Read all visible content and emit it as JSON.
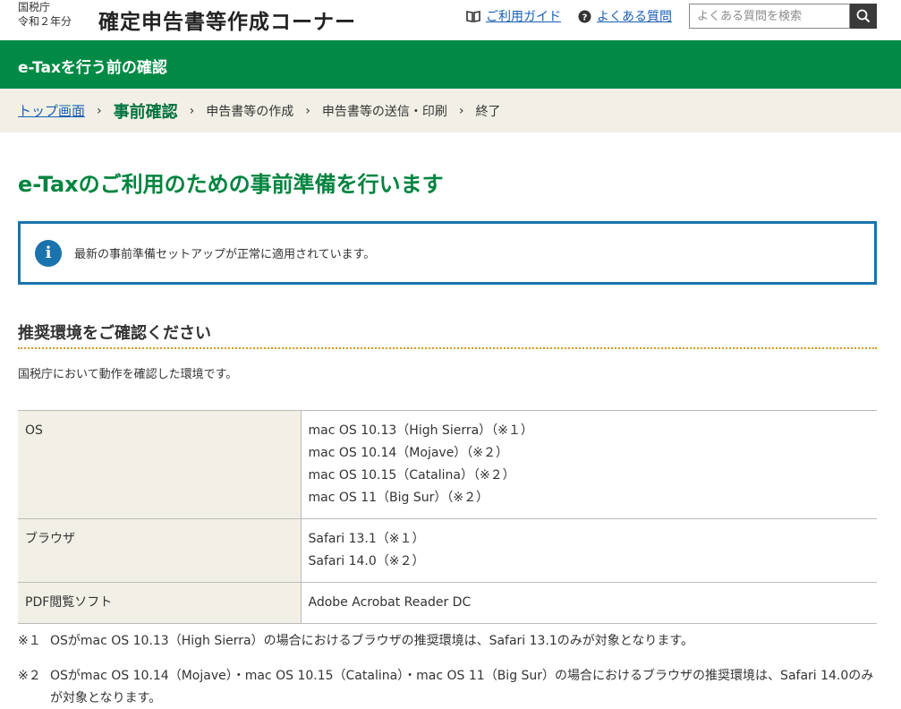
{
  "header": {
    "agency_line1": "国税庁",
    "agency_line2": "令和２年分",
    "site_title": "確定申告書等作成コーナー",
    "guide_link": "ご利用ガイド",
    "faq_link": "よくある質問",
    "search_placeholder": "よくある質問を検索",
    "icons": {
      "guide": "book-icon",
      "faq": "question-circle-icon",
      "search": "magnifier-icon"
    }
  },
  "band": {
    "title": "e-Taxを行う前の確認"
  },
  "breadcrumb": {
    "items": [
      {
        "label": "トップ画面",
        "state": "link"
      },
      {
        "label": "事前確認",
        "state": "current"
      },
      {
        "label": "申告書等の作成",
        "state": "upcoming"
      },
      {
        "label": "申告書等の送信・印刷",
        "state": "upcoming"
      },
      {
        "label": "終了",
        "state": "upcoming"
      }
    ],
    "separator": "›"
  },
  "main": {
    "heading": "e-Taxのご利用のための事前準備を行います",
    "info": {
      "icon": "info-icon",
      "icon_glyph": "i",
      "text": "最新の事前準備セットアップが正常に適用されています。"
    },
    "section_heading": "推奨環境をご確認ください",
    "lead": "国税庁において動作を確認した環境です。",
    "table": {
      "rows": [
        {
          "label": "OS",
          "values": [
            "mac OS 10.13（High Sierra）（※１）",
            "mac OS 10.14（Mojave）（※２）",
            "mac OS 10.15（Catalina）（※２）",
            "mac OS 11（Big Sur）（※２）"
          ]
        },
        {
          "label": "ブラウザ",
          "values": [
            "Safari 13.1（※１）",
            "Safari 14.0（※２）"
          ]
        },
        {
          "label": "PDF閲覧ソフト",
          "values": [
            "Adobe Acrobat Reader DC"
          ]
        }
      ]
    },
    "notes": [
      {
        "mark": "※１",
        "text": "OSがmac OS 10.13（High Sierra）の場合におけるブラウザの推奨環境は、Safari 13.1のみが対象となります。"
      },
      {
        "mark": "※２",
        "text": "OSがmac OS 10.14（Mojave）・mac OS 10.15（Catalina）・mac OS 11（Big Sur）の場合におけるブラウザの推奨環境は、Safari 14.0のみが対象となります。"
      }
    ]
  },
  "colors": {
    "brand_green": "#008a45",
    "heading_green": "#00843f",
    "info_blue": "#1a73ad",
    "link_blue": "#1a5fb4",
    "breadcrumb_bg": "#f2f0e6",
    "dotted_rule": "#d59a1c"
  }
}
